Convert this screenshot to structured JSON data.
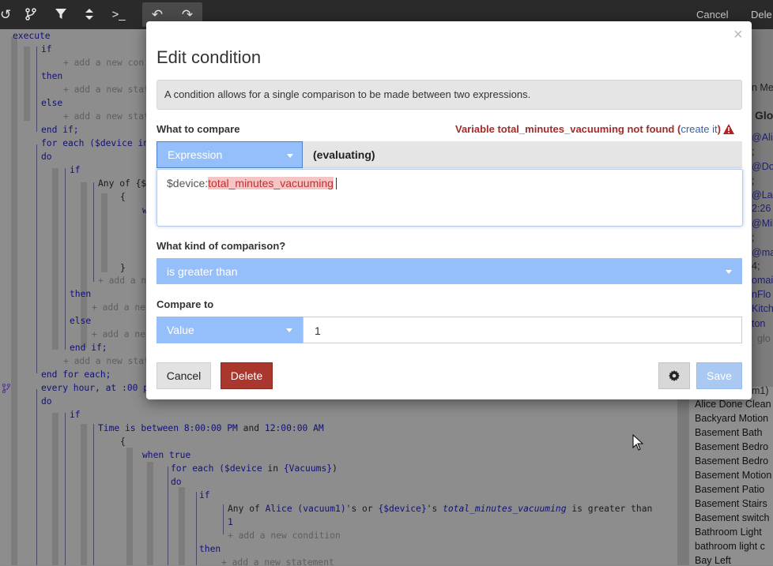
{
  "toolbar": {
    "cancel_label": "Cancel",
    "delete_label": "Dele"
  },
  "code": {
    "execute": "execute",
    "if1": "if",
    "add_condition_1": "+ add a new con",
    "then1": "then",
    "add_statement_1": "+ add a new stat",
    "else1": "else",
    "add_statement_2": "+ add a new stat",
    "endif1": "end if;",
    "foreach1": "for each ($device in",
    "do1": "do",
    "if2": "if",
    "anyof1": "Any of {$d",
    "brace_open_1": "{",
    "w": "w",
    "brace_close_1": "}",
    "add_n1": "+ add a ne",
    "then2": "then",
    "add_n2": "+ add a ne",
    "else2": "else",
    "add_n3": "+ add a ne",
    "endif2": "end if;",
    "add_stat_3": "+ add a new stat",
    "endforeach": "end for each;",
    "every_hour": "every hour, at :00 p",
    "do2": "do",
    "if3": "if",
    "time_is_between": "Time is between",
    "t1": "8:00:00 PM",
    "and": "and",
    "t2": "12:00:00 AM",
    "brace_open_2": "{",
    "when_true": "when true",
    "foreach2_a": "for each (",
    "foreach2_var": "$device",
    "foreach2_in": " in ",
    "foreach2_list": "{Vacuums}",
    "foreach2_b": ")",
    "do3": "do",
    "if4": "if",
    "anyof2_a": "Any of ",
    "anyof2_alice": "Alice (vacuum1)",
    "anyof2_b": "'s or ",
    "anyof2_dev": "{$device}",
    "anyof2_c": "'s ",
    "anyof2_attr": "total_minutes_vacuuming",
    "anyof2_d": " is greater than",
    "value_1": "1",
    "add_condition_2": "+ add a new condition",
    "then3": "then",
    "add_statement_4": "+ add a new statement"
  },
  "right_panel": {
    "fragments": [
      "n Me",
      "Glo",
      "@Alic",
      ";",
      "@Do",
      ";",
      "@Las",
      "2:26",
      "@Mil",
      ";",
      "@ma",
      "4;",
      "omai",
      "nFlo",
      "Kitch",
      "ton",
      "glo",
      "m1)"
    ],
    "items": [
      "Alice Done Clean",
      "Backyard Motion",
      "Basement Bath",
      "Basement Bedro",
      "Basement Bedro",
      "Basement Motion",
      "Basement Patio",
      "Basement Stairs",
      "Basement switch",
      "Bathroom Light",
      "bathroom light c",
      "Bay Left"
    ]
  },
  "modal": {
    "title": "Edit condition",
    "close": "×",
    "info": "A condition allows for a single comparison to be made between two expressions.",
    "what_to_compare": "What to compare",
    "error_prefix": "Variable total_minutes_vacuuming not found (",
    "error_link": "create it",
    "error_suffix": ")",
    "expression_select": "Expression",
    "evaluating": "(evaluating)",
    "expr_prefix": "$device:",
    "expr_var": "total_minutes_vacuuming",
    "comparison_label": "What kind of comparison?",
    "comparison_value": "is greater than",
    "compare_to_label": "Compare to",
    "value_select": "Value",
    "value_input": "1",
    "cancel": "Cancel",
    "delete": "Delete",
    "save": "Save"
  },
  "colors": {
    "accent_blue": "#95bffa",
    "delete_red": "#a9372e",
    "error_red": "#a52a2a",
    "keyword_blue": "#10107a"
  }
}
